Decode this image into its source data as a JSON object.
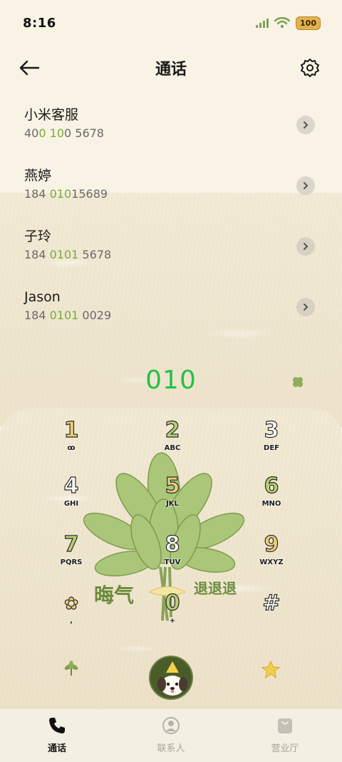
{
  "status": {
    "time": "8:16",
    "battery": "100"
  },
  "header": {
    "title": "通话"
  },
  "contacts": [
    {
      "name": "小米客服",
      "num_parts": [
        "40",
        "0",
        " ",
        "10",
        "0 5678"
      ]
    },
    {
      "name": "燕婷",
      "num_parts": [
        "184 ",
        "010",
        "",
        "",
        "15689"
      ]
    },
    {
      "name": "子玲",
      "num_parts": [
        "184 ",
        "0101",
        "",
        "",
        " 5678"
      ]
    },
    {
      "name": "Jason",
      "num_parts": [
        "184 ",
        "0101",
        "",
        "",
        " 0029"
      ]
    }
  ],
  "dial": {
    "number": "010"
  },
  "keypad": {
    "slogan_main": "晦气",
    "slogan_sub": "退退退",
    "keys": [
      {
        "digit": "1",
        "letters": "ꝏ",
        "color": "#e9cf7a"
      },
      {
        "digit": "2",
        "letters": "ABC",
        "color": "#b8cf72"
      },
      {
        "digit": "3",
        "letters": "DEF",
        "color": "#ffffff"
      },
      {
        "digit": "4",
        "letters": "GHI",
        "color": "#ffffff"
      },
      {
        "digit": "5",
        "letters": "JKL",
        "color": "#e9cf7a"
      },
      {
        "digit": "6",
        "letters": "MNO",
        "color": "#b8cf72"
      },
      {
        "digit": "7",
        "letters": "PQRS",
        "color": "#b8cf72"
      },
      {
        "digit": "8",
        "letters": "TUV",
        "color": "#ffffff"
      },
      {
        "digit": "9",
        "letters": "WXYZ",
        "color": "#e9cf7a"
      },
      {
        "digit": "✿",
        "letters": ",",
        "color": "#e9cf7a"
      },
      {
        "digit": "0",
        "letters": "+",
        "color": "#b8cf72"
      },
      {
        "digit": "#",
        "letters": "",
        "color": "#ffffff"
      }
    ]
  },
  "tabs": [
    {
      "label": "通话",
      "icon": "phone-icon",
      "active": true
    },
    {
      "label": "联系人",
      "icon": "person-icon",
      "active": false
    },
    {
      "label": "营业厅",
      "icon": "bag-icon",
      "active": false
    }
  ]
}
